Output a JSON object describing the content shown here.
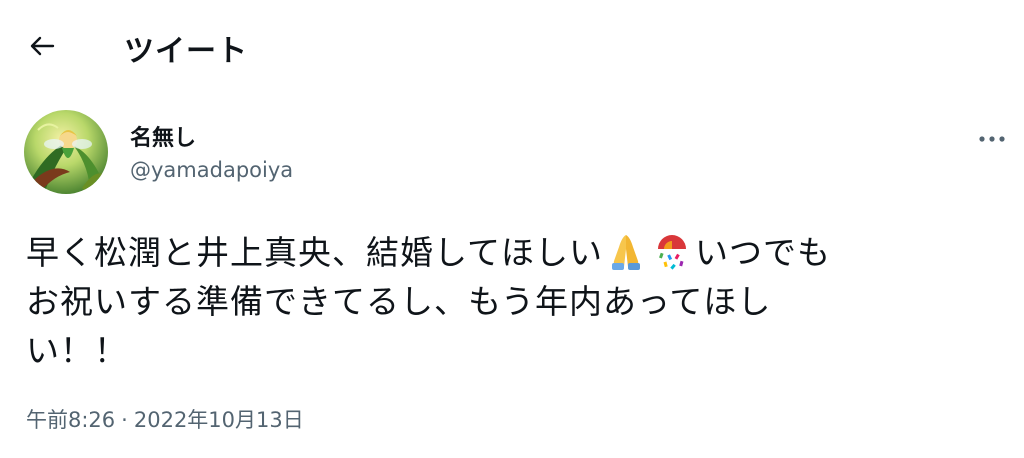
{
  "header": {
    "back_icon": "arrow-left-icon",
    "title": "ツイート"
  },
  "tweet": {
    "author": {
      "display_name": "名無し",
      "handle": "@yamadapoiya",
      "avatar_icon": "tinkerbell-avatar-icon"
    },
    "more_icon": "more-dots-icon",
    "text_lines": [
      {
        "before": "早く松潤と井上真央、結婚してほしい",
        "emojis": [
          "folded-hands-emoji",
          "confetti-ball-emoji"
        ],
        "after": "いつでも"
      },
      {
        "text": "お祝いする準備できてるし、もう年内あってほし"
      },
      {
        "text": "い！！"
      }
    ],
    "timestamp": {
      "time": "午前8:26",
      "separator": "·",
      "date": "2022年10月13日"
    }
  }
}
